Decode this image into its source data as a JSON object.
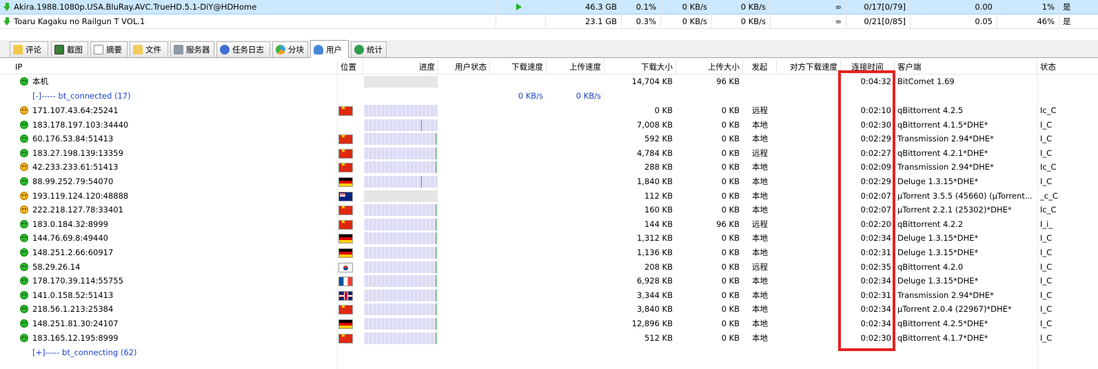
{
  "tasks": [
    {
      "name": "Akira.1988.1080p.USA.BluRay.AVC.TrueHD.5.1-DiY@HDHome",
      "size": "46.3 GB",
      "ratio_a": "0.1%",
      "down": "0 KB/s",
      "up": "0 KB/s",
      "remain": "∞",
      "seeds": "0/17[0/79]",
      "share": "0.00",
      "progress": "1%",
      "flag": "是",
      "playing": true
    },
    {
      "name": "Toaru Kagaku no Railgun T VOL.1",
      "size": "23.1 GB",
      "ratio_a": "0.3%",
      "down": "0 KB/s",
      "up": "0 KB/s",
      "remain": "∞",
      "seeds": "0/21[0/85]",
      "share": "0.05",
      "progress": "46%",
      "flag": "是",
      "playing": false
    }
  ],
  "tabs": [
    "评论",
    "截图",
    "摘要",
    "文件",
    "服务器",
    "任务日志",
    "分块",
    "用户",
    "统计"
  ],
  "active_tab": "用户",
  "columns": {
    "ip": "IP",
    "loc": "位置",
    "progress": "进度",
    "user_state": "用户状态",
    "down_speed": "下载速度",
    "up_speed": "上传速度",
    "downloaded": "下载大小",
    "uploaded": "上传大小",
    "initiator": "发起",
    "peer_down_speed": "对方下载速度",
    "connect_time": "连接时间",
    "client": "客户端",
    "state": "状态"
  },
  "local": {
    "ip": "本机",
    "downloaded": "14,704 KB",
    "uploaded": "96 KB",
    "connect_time": "0:04:32",
    "client": "BitComet 1.69"
  },
  "group_connected": {
    "label": "[-]----- bt_connected (17)",
    "down_speed": "0 KB/s",
    "up_speed": "0 KB/s"
  },
  "peers": [
    {
      "ip": "171.107.43.64:25241",
      "smile": "o",
      "flag": "cn",
      "bar": null,
      "downloaded": "0 KB",
      "uploaded": "0 KB",
      "initiator": "远程",
      "connect_time": "0:02:10",
      "client": "qBittorrent 4.2.5",
      "state": "Ic_C"
    },
    {
      "ip": "183.178.197.103:34440",
      "smile": "g",
      "flag": "",
      "bar": 0.78,
      "downloaded": "7,008 KB",
      "uploaded": "0 KB",
      "initiator": "本地",
      "connect_time": "0:02:30",
      "client": "qBittorrent 4.1.5*DHE*",
      "state": "I_C"
    },
    {
      "ip": "60.176.53.84:51413",
      "smile": "g",
      "flag": "cn",
      "bar": 0.98,
      "downloaded": "592 KB",
      "uploaded": "0 KB",
      "initiator": "本地",
      "connect_time": "0:02:29",
      "client": "Transmission 2.94*DHE*",
      "state": "I_C"
    },
    {
      "ip": "183.27.198.139:13359",
      "smile": "g",
      "flag": "cn",
      "bar": 0.98,
      "downloaded": "4,784 KB",
      "uploaded": "0 KB",
      "initiator": "远程",
      "connect_time": "0:02:27",
      "client": "qBittorrent 4.2.1*DHE*",
      "state": "I_C"
    },
    {
      "ip": "42.233.233.61:51413",
      "smile": "o",
      "flag": "cn",
      "bar": 0.98,
      "downloaded": "288 KB",
      "uploaded": "0 KB",
      "initiator": "本地",
      "connect_time": "0:02:09",
      "client": "Transmission 2.94*DHE*",
      "state": "Ic_C"
    },
    {
      "ip": "88.99.252.79:54070",
      "smile": "g",
      "flag": "de",
      "bar": 0.78,
      "downloaded": "1,840 KB",
      "uploaded": "0 KB",
      "initiator": "本地",
      "connect_time": "0:02:29",
      "client": "Deluge 1.3.15*DHE*",
      "state": "I_C"
    },
    {
      "ip": "193.119.124.120:48888",
      "smile": "o",
      "flag": "au",
      "bar": "grey",
      "downloaded": "112 KB",
      "uploaded": "0 KB",
      "initiator": "本地",
      "connect_time": "0:02:07",
      "client": "µTorrent 3.5.5 (45660) (µTorrent...",
      "state": "_c_C"
    },
    {
      "ip": "222.218.127.78:33401",
      "smile": "o",
      "flag": "cn",
      "bar": 0.98,
      "downloaded": "160 KB",
      "uploaded": "0 KB",
      "initiator": "本地",
      "connect_time": "0:02:07",
      "client": "µTorrent 2.2.1 (25302)*DHE*",
      "state": "Ic_C"
    },
    {
      "ip": "183.0.184.32:8999",
      "smile": "g",
      "flag": "cn",
      "bar": 0.98,
      "downloaded": "144 KB",
      "uploaded": "96 KB",
      "initiator": "远程",
      "connect_time": "0:02:20",
      "client": "qBittorrent 4.2.2",
      "state": "I_i_"
    },
    {
      "ip": "144.76.69.8:49440",
      "smile": "g",
      "flag": "de",
      "bar": 0.98,
      "downloaded": "1,312 KB",
      "uploaded": "0 KB",
      "initiator": "本地",
      "connect_time": "0:02:34",
      "client": "Deluge 1.3.15*DHE*",
      "state": "I_C"
    },
    {
      "ip": "148.251.2.66:60917",
      "smile": "g",
      "flag": "de",
      "bar": 0.98,
      "downloaded": "1,136 KB",
      "uploaded": "0 KB",
      "initiator": "本地",
      "connect_time": "0:02:31",
      "client": "Deluge 1.3.15*DHE*",
      "state": "I_C"
    },
    {
      "ip": "58.29.26.14",
      "smile": "g",
      "flag": "kr",
      "bar": 0.98,
      "downloaded": "208 KB",
      "uploaded": "0 KB",
      "initiator": "远程",
      "connect_time": "0:02:35",
      "client": "qBittorrent 4.2.0",
      "state": "I_C"
    },
    {
      "ip": "178.170.39.114:55755",
      "smile": "g",
      "flag": "fr",
      "bar": 0.98,
      "downloaded": "6,928 KB",
      "uploaded": "0 KB",
      "initiator": "本地",
      "connect_time": "0:02:34",
      "client": "Deluge 1.3.15*DHE*",
      "state": "I_C"
    },
    {
      "ip": "141.0.158.52:51413",
      "smile": "g",
      "flag": "gb",
      "bar": 0.98,
      "downloaded": "3,344 KB",
      "uploaded": "0 KB",
      "initiator": "本地",
      "connect_time": "0:02:31",
      "client": "Transmission 2.94*DHE*",
      "state": "I_C"
    },
    {
      "ip": "218.56.1.213:25384",
      "smile": "g",
      "flag": "cn",
      "bar": 0.98,
      "downloaded": "3,840 KB",
      "uploaded": "0 KB",
      "initiator": "本地",
      "connect_time": "0:02:34",
      "client": "µTorrent 2.0.4 (22967)*DHE*",
      "state": "I_C"
    },
    {
      "ip": "148.251.81.30:24107",
      "smile": "g",
      "flag": "de",
      "bar": 0.98,
      "downloaded": "12,896 KB",
      "uploaded": "0 KB",
      "initiator": "本地",
      "connect_time": "0:02:34",
      "client": "qBittorrent 4.2.5*DHE*",
      "state": "I_C"
    },
    {
      "ip": "183.165.12.195:8999",
      "smile": "g",
      "flag": "cn",
      "bar": 0.98,
      "downloaded": "512 KB",
      "uploaded": "0 KB",
      "initiator": "本地",
      "connect_time": "0:02:30",
      "client": "qBittorrent 4.1.7*DHE*",
      "state": "I_C"
    }
  ],
  "group_connecting": {
    "label": "[+]----- bt_connecting (62)"
  },
  "colors": {
    "selected_row": "#cce8ff",
    "progress_bar": "#dcdcf6",
    "progress_done": "#23b823",
    "highlight_box": "#e6211f",
    "group_text": "#1a44cc"
  }
}
